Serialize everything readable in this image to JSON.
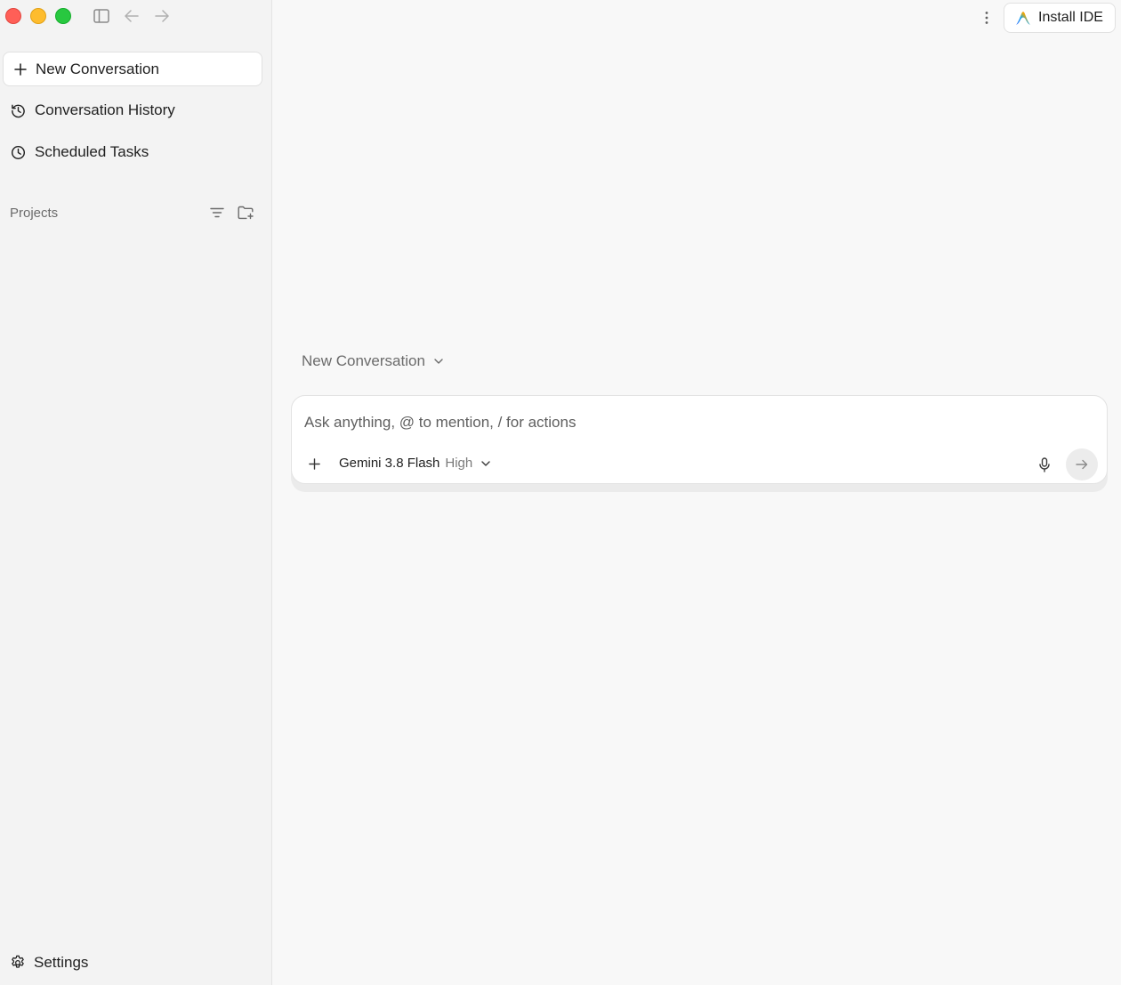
{
  "sidebar": {
    "new_conversation_label": "New Conversation",
    "items": [
      {
        "label": "Conversation History",
        "icon": "history-icon"
      },
      {
        "label": "Scheduled Tasks",
        "icon": "clock-icon"
      }
    ],
    "projects_label": "Projects",
    "settings_label": "Settings"
  },
  "header": {
    "install_ide_label": "Install IDE"
  },
  "main": {
    "conversation_select_label": "New Conversation",
    "composer": {
      "placeholder": "Ask anything, @ to mention, / for actions",
      "value": "",
      "model_name": "Gemini 3.8 Flash",
      "model_level": "High"
    }
  },
  "colors": {
    "close": "#ff5f57",
    "minimize": "#febc2e",
    "zoom": "#28c840",
    "sidebar_bg": "#f3f3f3",
    "main_bg": "#f8f8f8"
  }
}
